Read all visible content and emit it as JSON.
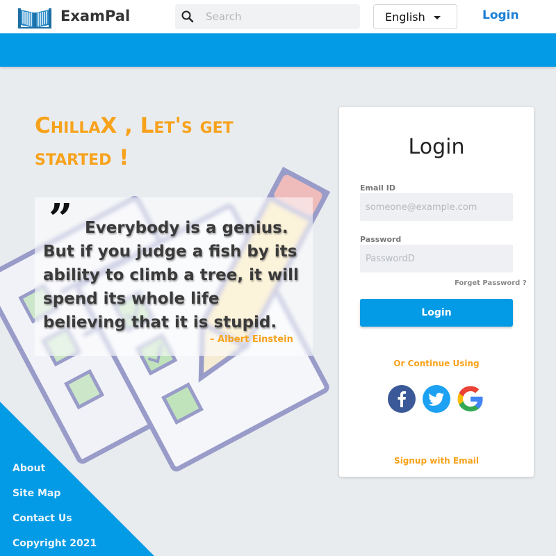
{
  "header": {
    "brand": "ExamPal",
    "search_placeholder": "Search",
    "language": "English",
    "login_label": "Login"
  },
  "hero": {
    "heading": "ChillaX , Let's get started !",
    "quote": "Everybody is a genius. But if you judge a fish by its ability to climb a tree, it will spend its whole life believing that it is stupid.",
    "author": "– Albert Einstein"
  },
  "login_card": {
    "title": "Login",
    "email_label": "Email ID",
    "email_placeholder": "someone@example.com",
    "password_label": "Password",
    "password_placeholder": "PasswordD",
    "forgot_label": "Forget Password ?",
    "login_button": "Login",
    "or_continue": "Or Continue Using",
    "signup_label": "Signup with Email",
    "social_icons": [
      "facebook-icon",
      "twitter-icon",
      "google-icon"
    ]
  },
  "footer": {
    "links": [
      "About",
      "Site Map",
      "Contact Us",
      "Copyright 2021"
    ]
  },
  "colors": {
    "primary_blue": "#039be5",
    "accent_orange": "#f7a21b",
    "link_blue": "#1a7fd4",
    "background": "#e9ecef"
  }
}
